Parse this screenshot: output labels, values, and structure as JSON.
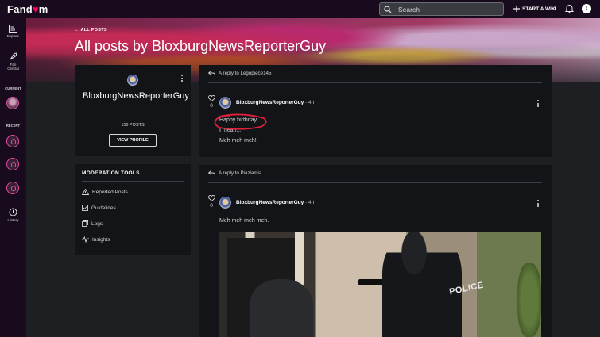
{
  "topbar": {
    "logo_pre": "Fand",
    "logo_heart": "♥",
    "logo_post": "m",
    "search_placeholder": "Search",
    "start_wiki": "START A WIKI",
    "user_initial": "!"
  },
  "sidebar": {
    "explore": "Explore",
    "fan_central_1": "Fan",
    "fan_central_2": "Central",
    "current": "CURRENT",
    "recent": "RECENT",
    "history": "History"
  },
  "header": {
    "back_link": "ALL POSTS",
    "title": "All posts by BloxburgNewsReporterGuy"
  },
  "profile": {
    "name": "BloxburgNewsReporterGuy",
    "posts_count": "156 POSTS",
    "view_profile": "VIEW PROFILE"
  },
  "moderation": {
    "title": "MODERATION TOOLS",
    "items": [
      "Reported Posts",
      "Guidelines",
      "Logs",
      "Insights"
    ]
  },
  "posts": [
    {
      "reply_to": "A reply to Legopiece145",
      "likes": "0",
      "author": "BloxburgNewsReporterGuy",
      "time": "4m",
      "lines": [
        "Happy birthday.",
        "I mean...",
        "Meh meh meh!"
      ]
    },
    {
      "reply_to": "A reply to Piaziamia",
      "likes": "0",
      "author": "BloxburgNewsReporterGuy",
      "time": "4m",
      "lines": [
        "Meh meh meh meh."
      ],
      "image_text": "POLICE"
    }
  ],
  "colors": {
    "accent": "#fa005a",
    "background": "#1e1f23",
    "card": "#131418",
    "annotation": "#e0203a"
  }
}
